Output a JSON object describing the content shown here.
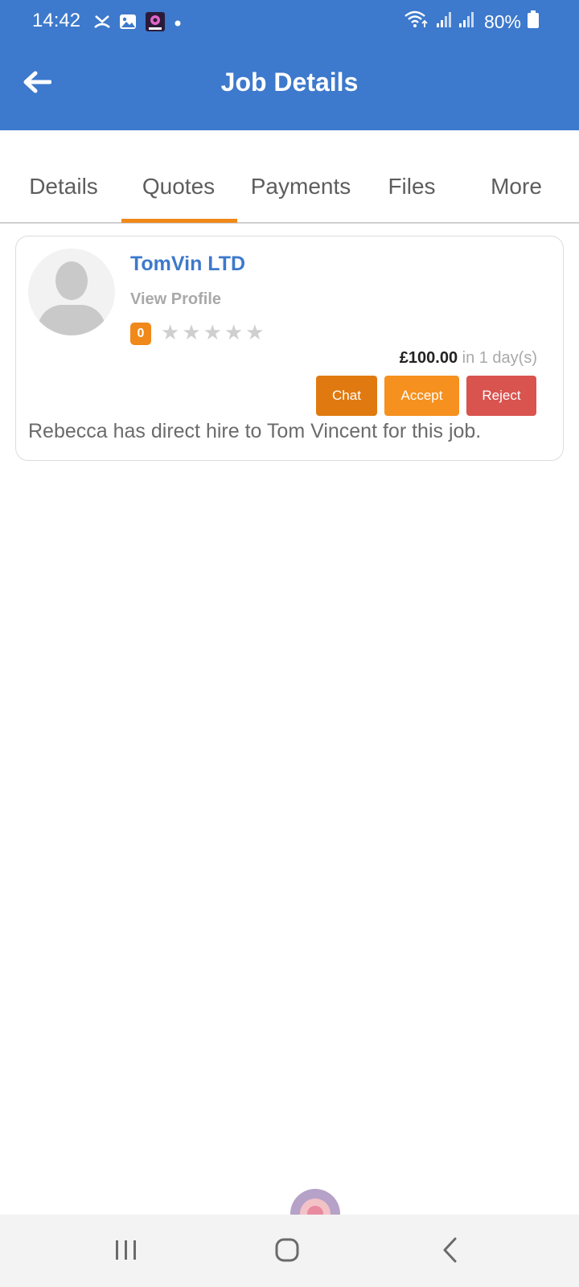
{
  "status_bar": {
    "time": "14:42",
    "battery": "80%",
    "left_icons": [
      "missed-call-icon",
      "gallery-icon",
      "app-notification-icon",
      "dot-icon"
    ],
    "right_icons": [
      "wifi-icon",
      "signal-icon",
      "signal-icon",
      "battery-icon"
    ]
  },
  "app_bar": {
    "title": "Job Details",
    "back_icon": "arrow-left-icon",
    "background_color": "#3d79cc"
  },
  "tabs": {
    "items": [
      {
        "label": "Details"
      },
      {
        "label": "Quotes"
      },
      {
        "label": "Payments"
      },
      {
        "label": "Files"
      },
      {
        "label": "More"
      }
    ],
    "active": "Quotes",
    "active_color": "#f0891a"
  },
  "quote": {
    "company_name": "TomVin LTD",
    "view_profile_label": "View Profile",
    "rating_count": "0",
    "stars": [
      "★",
      "★",
      "★",
      "★",
      "★"
    ],
    "stars_filled": 0,
    "price": "£100.00",
    "duration": "in 1 day(s)",
    "buttons": {
      "chat": "Chat",
      "accept": "Accept",
      "reject": "Reject"
    },
    "message": "Rebecca has direct hire to Tom Vincent for this job."
  },
  "nav_bar": {
    "recents_icon": "recents-icon",
    "home_icon": "home-icon",
    "back_icon": "back-chevron-icon"
  }
}
